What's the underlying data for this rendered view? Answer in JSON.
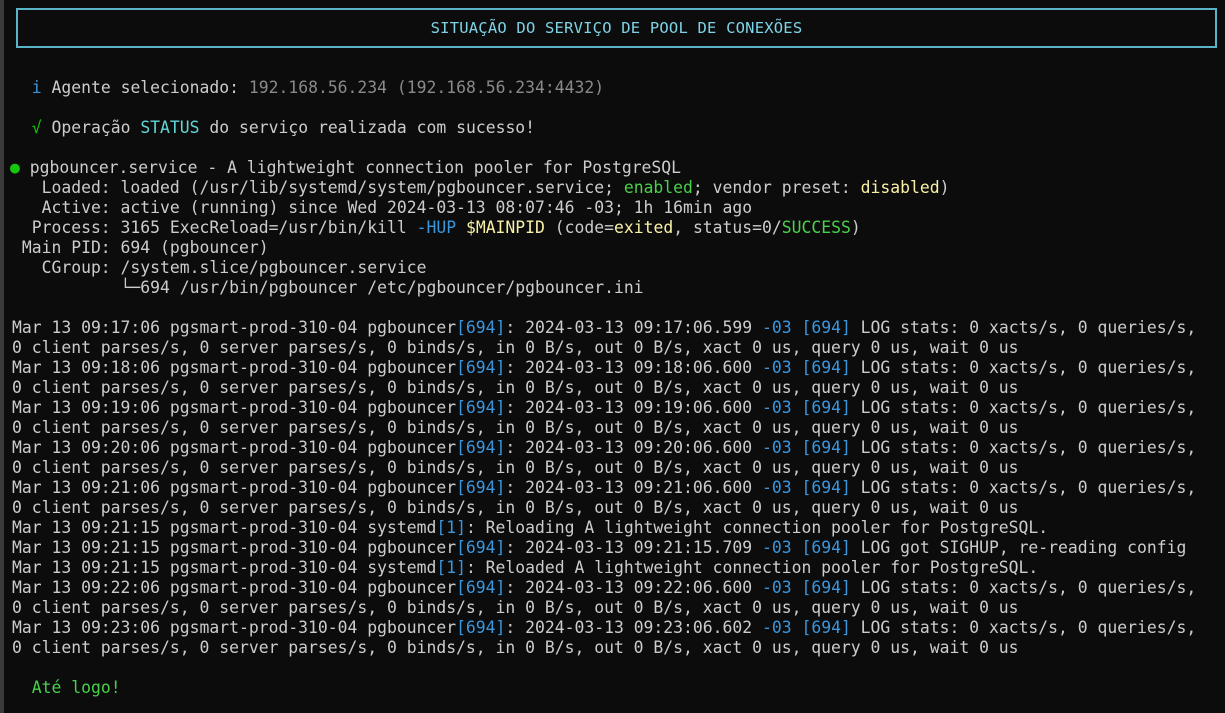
{
  "banner": {
    "title": "SITUAÇÃO DO SERVIÇO DE POOL DE CONEXÕES"
  },
  "agent": {
    "icon": "i",
    "label": "Agente selecionado: ",
    "value": "192.168.56.234 (192.168.56.234:4432)"
  },
  "operation": {
    "icon": "√",
    "pre": "Operação ",
    "keyword": "STATUS",
    "post": " do serviço realizada com sucesso!"
  },
  "service": {
    "bullet": "●",
    "header": " pgbouncer.service - A lightweight connection pooler for PostgreSQL",
    "loaded_pre": "   Loaded: loaded (/usr/lib/systemd/system/pgbouncer.service; ",
    "loaded_enabled": "enabled",
    "loaded_mid": "; vendor preset: ",
    "loaded_disabled": "disabled",
    "loaded_post": ")",
    "active": "   Active: active (running) since Wed 2024-03-13 08:07:46 -03; 1h 16min ago",
    "process_pre": "  Process: 3165 ExecReload=/usr/bin/kill ",
    "process_hup": "-HUP",
    "process_sp": " ",
    "process_pid": "$MAINPID",
    "process_mid": " (code=",
    "process_exited": "exited",
    "process_mid2": ", status=0/",
    "process_success": "SUCCESS",
    "process_post": ")",
    "mainpid": " Main PID: 694 (pgbouncer)",
    "cgroup": "   CGroup: /system.slice/pgbouncer.service",
    "cgroup_child": "           └─694 /usr/bin/pgbouncer /etc/pgbouncer/pgbouncer.ini"
  },
  "logs": [
    {
      "p1": "Mar 13 09:17:06 pgsmart-prod-310-04 pgbouncer",
      "b1": "[694]",
      "p2": ": 2024-03-13 09:17:06.599 ",
      "tz": "-03",
      "p3": " ",
      "b2": "[694]",
      "p4": " LOG stats: 0 xacts/s, 0 queries/s,"
    },
    {
      "p1": "0 client parses/s, 0 server parses/s, 0 binds/s, in 0 B/s, out 0 B/s, xact 0 us, query 0 us, wait 0 us"
    },
    {
      "p1": "Mar 13 09:18:06 pgsmart-prod-310-04 pgbouncer",
      "b1": "[694]",
      "p2": ": 2024-03-13 09:18:06.600 ",
      "tz": "-03",
      "p3": " ",
      "b2": "[694]",
      "p4": " LOG stats: 0 xacts/s, 0 queries/s,"
    },
    {
      "p1": "0 client parses/s, 0 server parses/s, 0 binds/s, in 0 B/s, out 0 B/s, xact 0 us, query 0 us, wait 0 us"
    },
    {
      "p1": "Mar 13 09:19:06 pgsmart-prod-310-04 pgbouncer",
      "b1": "[694]",
      "p2": ": 2024-03-13 09:19:06.600 ",
      "tz": "-03",
      "p3": " ",
      "b2": "[694]",
      "p4": " LOG stats: 0 xacts/s, 0 queries/s,"
    },
    {
      "p1": "0 client parses/s, 0 server parses/s, 0 binds/s, in 0 B/s, out 0 B/s, xact 0 us, query 0 us, wait 0 us"
    },
    {
      "p1": "Mar 13 09:20:06 pgsmart-prod-310-04 pgbouncer",
      "b1": "[694]",
      "p2": ": 2024-03-13 09:20:06.600 ",
      "tz": "-03",
      "p3": " ",
      "b2": "[694]",
      "p4": " LOG stats: 0 xacts/s, 0 queries/s,"
    },
    {
      "p1": "0 client parses/s, 0 server parses/s, 0 binds/s, in 0 B/s, out 0 B/s, xact 0 us, query 0 us, wait 0 us"
    },
    {
      "p1": "Mar 13 09:21:06 pgsmart-prod-310-04 pgbouncer",
      "b1": "[694]",
      "p2": ": 2024-03-13 09:21:06.600 ",
      "tz": "-03",
      "p3": " ",
      "b2": "[694]",
      "p4": " LOG stats: 0 xacts/s, 0 queries/s,"
    },
    {
      "p1": "0 client parses/s, 0 server parses/s, 0 binds/s, in 0 B/s, out 0 B/s, xact 0 us, query 0 us, wait 0 us"
    },
    {
      "p1": "Mar 13 09:21:15 pgsmart-prod-310-04 systemd",
      "b1": "[1]",
      "p2": ": Reloading A lightweight connection pooler for PostgreSQL."
    },
    {
      "p1": "Mar 13 09:21:15 pgsmart-prod-310-04 pgbouncer",
      "b1": "[694]",
      "p2": ": 2024-03-13 09:21:15.709 ",
      "tz": "-03",
      "p3": " ",
      "b2": "[694]",
      "p4": " LOG got SIGHUP, re-reading config"
    },
    {
      "p1": "Mar 13 09:21:15 pgsmart-prod-310-04 systemd",
      "b1": "[1]",
      "p2": ": Reloaded A lightweight connection pooler for PostgreSQL."
    },
    {
      "p1": "Mar 13 09:22:06 pgsmart-prod-310-04 pgbouncer",
      "b1": "[694]",
      "p2": ": 2024-03-13 09:22:06.600 ",
      "tz": "-03",
      "p3": " ",
      "b2": "[694]",
      "p4": " LOG stats: 0 xacts/s, 0 queries/s,"
    },
    {
      "p1": "0 client parses/s, 0 server parses/s, 0 binds/s, in 0 B/s, out 0 B/s, xact 0 us, query 0 us, wait 0 us"
    },
    {
      "p1": "Mar 13 09:23:06 pgsmart-prod-310-04 pgbouncer",
      "b1": "[694]",
      "p2": ": 2024-03-13 09:23:06.602 ",
      "tz": "-03",
      "p3": " ",
      "b2": "[694]",
      "p4": " LOG stats: 0 xacts/s, 0 queries/s,"
    },
    {
      "p1": "0 client parses/s, 0 server parses/s, 0 binds/s, in 0 B/s, out 0 B/s, xact 0 us, query 0 us, wait 0 us"
    }
  ],
  "farewell": "Até logo!",
  "colors": {
    "background": "#0c0c0c",
    "banner_border": "#5ab4c8",
    "banner_text": "#7fd3e6",
    "pid_bracket": "#3a96dd",
    "success": "#16c60c",
    "warning": "#f9f1a5"
  }
}
